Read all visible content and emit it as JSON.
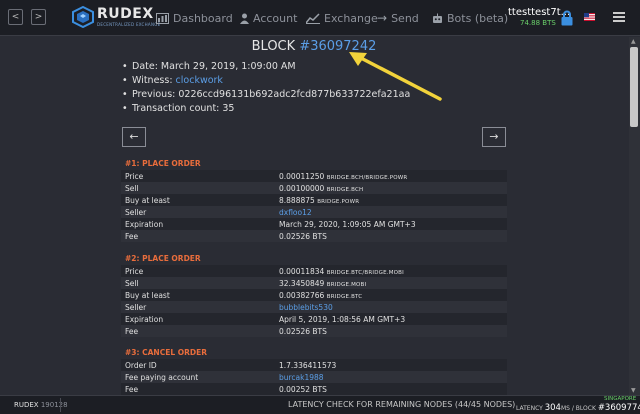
{
  "header": {
    "nav_back": "<",
    "nav_forward": ">",
    "logo_text": "RUDEX",
    "logo_sub": "DECENTRALIZED EXCHANGE",
    "nav": {
      "dashboard": "Dashboard",
      "account": "Account",
      "exchange": "Exchange",
      "send": "Send",
      "bots": "Bots (beta)"
    },
    "account_name": "ttesttest7t...",
    "account_balance": "74.88 BTS"
  },
  "block": {
    "title_prefix": "BLOCK",
    "number": "#36097242",
    "date": "Date: March 29, 2019, 1:09:00 AM",
    "witness_label": "Witness:",
    "witness": "clockwork",
    "previous": "Previous: 0226ccd96131b692adc2fcd877b633722efa21aa",
    "transaction_count": "Transaction count: 35"
  },
  "pager": {
    "prev": "←",
    "next": "→"
  },
  "operations": [
    {
      "title": "#1: PLACE ORDER",
      "rows": {
        "price_label": "Price",
        "price_value": "0.00011250",
        "price_unit": "BRIDGE.BCH/BRIDGE.POWR",
        "sell_label": "Sell",
        "sell_value": "0.00100000",
        "sell_unit": "BRIDGE.BCH",
        "buy_label": "Buy at least",
        "buy_value": "8.888875",
        "buy_unit": "BRIDGE.POWR",
        "seller_label": "Seller",
        "seller_value": "dxfloo12",
        "expiration_label": "Expiration",
        "expiration_value": "March 29, 2020, 1:09:05 AM GMT+3",
        "fee_label": "Fee",
        "fee_value": "0.02526 BTS"
      }
    },
    {
      "title": "#2: PLACE ORDER",
      "rows": {
        "price_label": "Price",
        "price_value": "0.00011834",
        "price_unit": "BRIDGE.BTC/BRIDGE.MOBI",
        "sell_label": "Sell",
        "sell_value": "32.3450849",
        "sell_unit": "BRIDGE.MOBI",
        "buy_label": "Buy at least",
        "buy_value": "0.00382766",
        "buy_unit": "BRIDGE.BTC",
        "seller_label": "Seller",
        "seller_value": "bubblebits530",
        "expiration_label": "Expiration",
        "expiration_value": "April 5, 2019, 1:08:56 AM GMT+3",
        "fee_label": "Fee",
        "fee_value": "0.02526 BTS"
      }
    },
    {
      "title": "#3: CANCEL ORDER",
      "rows": {
        "order_label": "Order ID",
        "order_value": "1.7.336411573",
        "account_label": "Fee paying account",
        "account_value": "burcak1988",
        "fee_label": "Fee",
        "fee_value": "0.00252 BTS"
      }
    }
  ],
  "footer": {
    "brand": "RUDEX",
    "version": "190128",
    "latency_msg": "LATENCY CHECK FOR REMAINING NODES (44/45 NODES)",
    "region": "SINGAPORE",
    "latency_label": "LATENCY",
    "latency_value": "304",
    "latency_unit": "MS / BLOCK",
    "block_value": "#36097741"
  }
}
